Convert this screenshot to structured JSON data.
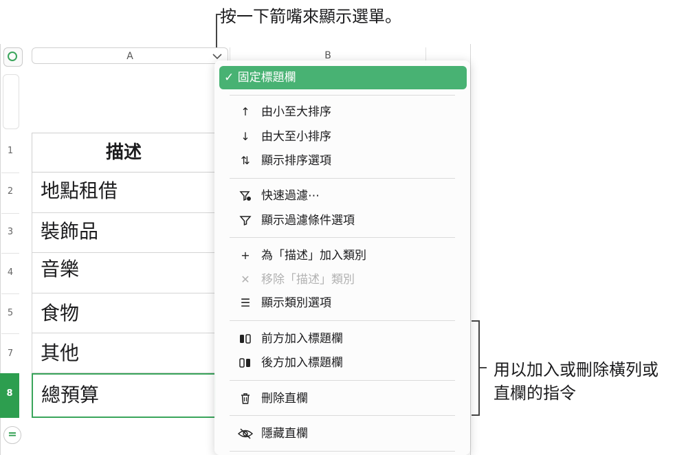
{
  "callouts": {
    "top": "按一下箭嘴來顯示選單。",
    "right_line1": "用以加入或刪除橫列或",
    "right_line2": "直欄的指令"
  },
  "sheet": {
    "column_headers": [
      "A",
      "B"
    ],
    "row_numbers": [
      "1",
      "2",
      "3",
      "4",
      "5",
      "7",
      "8"
    ],
    "header_cell": "描述",
    "cells": [
      "地點租借",
      "裝飾品",
      "音樂",
      "食物",
      "其他",
      "總預算"
    ],
    "selected_row": "8"
  },
  "menu": {
    "freeze": "固定標題欄",
    "sort_asc": "由小至大排序",
    "sort_desc": "由大至小排序",
    "show_sort": "顯示排序選項",
    "quick_filter": "快速過濾⋯",
    "show_filter": "顯示過濾條件選項",
    "add_category": "為「描述」加入類別",
    "remove_category": "移除「描述」類別",
    "show_category": "顯示類別選項",
    "add_col_before": "前方加入標題欄",
    "add_col_after": "後方加入標題欄",
    "delete_col": "刪除直欄",
    "hide_col": "隱藏直欄"
  },
  "colors": {
    "accent_green": "#48b273",
    "selection_green": "#2d9e4f"
  }
}
